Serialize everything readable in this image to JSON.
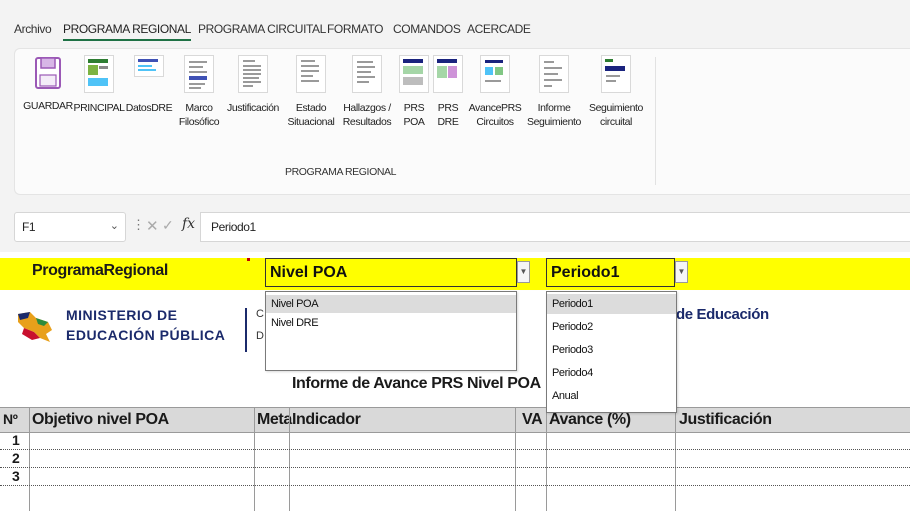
{
  "menu": {
    "items": [
      "Archivo",
      "PROGRAMA REGIONAL",
      "PROGRAMA CIRCUITAL",
      "FORMATO",
      "COMANDOS",
      "ACERCADE"
    ],
    "active_index": 1
  },
  "ribbon": {
    "buttons": [
      {
        "label": "GUARDAR",
        "icon": "save-icon"
      },
      {
        "label": "PRINCIPAL",
        "icon": "sheet-thumbnail-icon"
      },
      {
        "label": "DatosDRE",
        "icon": "sheet-thumbnail-icon"
      },
      {
        "label": "Marco\nFilosófico",
        "icon": "document-thumbnail-icon"
      },
      {
        "label": "Justificación",
        "icon": "document-thumbnail-icon"
      },
      {
        "label": "Estado\nSituacional",
        "icon": "document-thumbnail-icon"
      },
      {
        "label": "Hallazgos /\nResultados",
        "icon": "document-thumbnail-icon"
      },
      {
        "label": "PRS\nPOA",
        "icon": "sheet-thumbnail-icon"
      },
      {
        "label": "PRS\nDRE",
        "icon": "sheet-thumbnail-icon"
      },
      {
        "label": "AvancePRS\nCircuitos",
        "icon": "document-thumbnail-icon"
      },
      {
        "label": "Informe\nSeguimiento",
        "icon": "document-thumbnail-icon"
      },
      {
        "label": "Seguimiento\ncircuital",
        "icon": "sheet-thumbnail-icon"
      }
    ],
    "group_label": "PROGRAMA REGIONAL"
  },
  "formula_bar": {
    "name_box": "F1",
    "formula": "Periodo1"
  },
  "sheet": {
    "a1_text": "ProgramaRegional",
    "level_dropdown": {
      "value": "Nivel POA",
      "options": [
        "Nivel POA",
        "Nivel DRE"
      ],
      "highlighted_index": 0
    },
    "period_dropdown": {
      "value": "Periodo1",
      "options": [
        "Periodo1",
        "Periodo2",
        "Periodo3",
        "Periodo4",
        "Anual"
      ],
      "highlighted_index": 0
    },
    "logo": {
      "line1": "MINISTERIO DE",
      "line2": "EDUCACIÓN PÚBLICA",
      "colors": {
        "navy": "#1b2a6b",
        "gold": "#e8a01b",
        "red": "#c8102e",
        "green": "#2e8b3c"
      }
    },
    "org_fragments": [
      "C",
      "D"
    ],
    "header_right": "de Educación",
    "report_title": "Informe de Avance PRS  Nivel POA",
    "table": {
      "columns": [
        "Nº",
        "Objetivo nivel POA",
        "Meta",
        "Indicador",
        "VA",
        "Avance (%)",
        "Justificación"
      ],
      "rows": [
        "1",
        "2",
        "3"
      ]
    }
  },
  "colors": {
    "highlight_yellow": "#ffff00",
    "header_gray": "#d9d9d9",
    "accent_green": "#1e7145"
  }
}
